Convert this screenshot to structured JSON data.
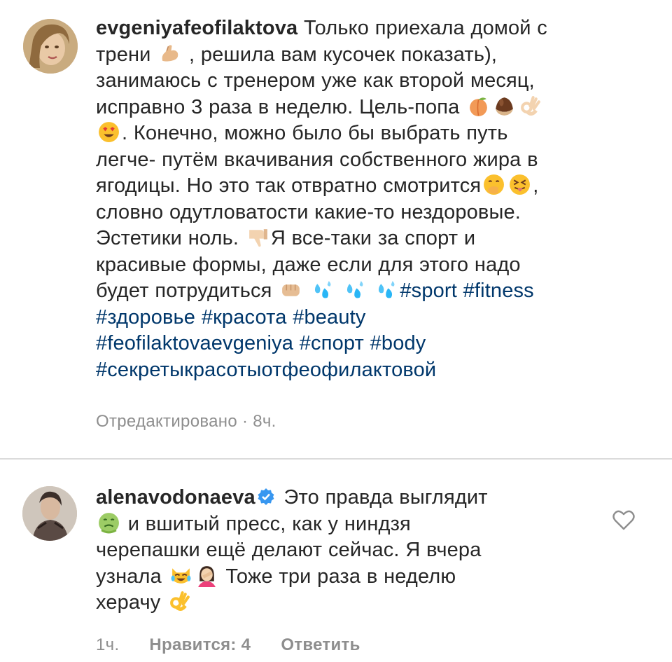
{
  "post": {
    "username": "evgeniyafeofilaktova",
    "lines": [
      "Только приехала домой с",
      "трени",
      ", решила вам кусочек показать),",
      "занимаюсь с тренером уже как второй месяц,",
      "исправно 3 раза в неделю. Цель-попа",
      ". Конечно, можно было бы выбрать путь",
      "легче- путём вкачивания собственного жира в",
      "ягодицы. Но это так отвратно смотрится",
      ",",
      "словно одутловатости какие-то нездоровые.",
      "Эстетики ноль.",
      "Я все-таки за спорт и",
      "красивые формы, даже если для этого надо",
      "будет потрудиться"
    ],
    "hashtags": [
      "#sport",
      "#fitness",
      "#здоровье",
      "#красота",
      "#beauty",
      "#feofilaktovaevgeniya",
      "#спорт",
      "#body",
      "#секретыкрасотыотфеофилактовой"
    ],
    "meta": "Отредактировано · 8ч."
  },
  "comment": {
    "username": "alenavodonaeva",
    "lines": [
      "Это правда выглядит",
      "и вшитый пресс, как у ниндзя",
      "черепашки ещё делают сейчас. Я вчера",
      "узнала",
      "Тоже три раза в неделю",
      "херачу"
    ],
    "time": "1ч.",
    "likes": "Нравится: 4",
    "reply": "Ответить"
  },
  "colors": {
    "text": "#262626",
    "hashtag": "#00376b",
    "meta": "#8e8e8e",
    "verified": "#3897f0",
    "divider": "#dbdbdb"
  },
  "icons": [
    "flexed-biceps-icon",
    "peach-icon",
    "chestnut-icon",
    "ok-hand-icon",
    "heart-eyes-icon",
    "hand-over-mouth-icon",
    "squinting-tongue-icon",
    "thumbs-down-icon",
    "fist-icon",
    "sweat-droplets-icon",
    "verified-badge-icon",
    "nauseated-face-icon",
    "cat-tears-of-joy-icon",
    "woman-facepalming-icon",
    "heart-outline-icon"
  ]
}
